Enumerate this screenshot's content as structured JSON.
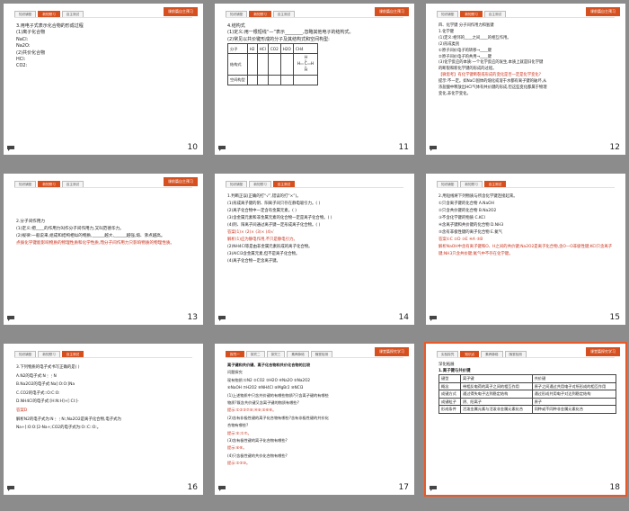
{
  "badge_text": "课前篇自主预习",
  "tabs_default": [
    "知识铺垫",
    "新知预习",
    "自主测试"
  ],
  "tabs_slide17": [
    "探究一",
    "探究二",
    "探究三",
    "素养脉络",
    "随堂检测"
  ],
  "tabs_slide18": [
    "实验探究",
    "知识点",
    "素养脉络",
    "随堂检测"
  ],
  "slides": [
    {
      "number": "10",
      "lines": [
        "3.用电子式表示化合物的形成过程",
        "(1)离子化合物",
        "NaCl:",
        "Na2O:",
        "(2)共价化合物",
        "HCl:",
        "CO2:"
      ]
    },
    {
      "number": "11",
      "lines": [
        "4.结构式",
        "(1)定义:用一根短线“—”表示________,忽略其他电子的结构式。",
        "(2)常见以共价键形成的分子及其结构式和空间构型:"
      ],
      "table": {
        "header": [
          "分子",
          "H2",
          "HCl",
          "CO2",
          "H2O",
          "CH4"
        ],
        "rows": [
          "结构式",
          "空间构型"
        ]
      }
    },
    {
      "number": "12",
      "lines": [
        "四、化学键 分子间作用力和氢键",
        "1.化学键",
        "(1)定义:相邻的____之间____的相互作用。",
        "(2)形成类别",
        "①原子间价电子的转移→____键",
        "②原子间价电子的共用→____键",
        "(3)化学反应的本质:一个化学反应的发生,本质上就是旧化学键",
        "的断裂和新化学键的形成的过程。",
        "【微思考】有化学键断裂或形成的变化是否一定是化学变化?",
        "提示:不一定。如NaCl固体的熔化或溶于水都有离子键的破坏,从",
        "浓盐酸中释放出HCl气体有共价键的形成,但这些变化都属于物理",
        "变化,非化学变化。"
      ]
    },
    {
      "number": "13",
      "lines": [
        "2.分子间作用力",
        "(1)定义:把____的作用力叫作分子间作用力,又叫范德华力。",
        "(2)规律:一般说来,组成和结构相似的物质,______越大,______越强,熔、沸点越高。",
        "点拨化学键能影响物质的物理性质和化学性质,而分子间作用力只影响物质的物理性质。"
      ]
    },
    {
      "number": "14",
      "lines": [
        "1.判断正误(正确的打“√”,错误的打“×”)。",
        "(1)形成离子键的阴、阳离子间只存在静电吸引力。(   )",
        "(2)离子化合物中一定含有金属元素。(   )",
        "(3)含金属元素和非金属元素的化合物一定是离子化合物。(   )",
        "(4)阴、阳离子间通过离子键一定形成离子化合物。(   )",
        "答案(1)×  (2)×  (3)×  (4)√",
        "解析(1)应为静电作用,不只是静电引力。",
        "(2)NH4Cl等是由非金属元素形成的离子化合物。",
        "(3)AlCl3含金属元素,但不是离子化合物。",
        "(4)离子化合物一定含离子键。"
      ]
    },
    {
      "number": "15",
      "lines": [
        "2.用短线将下列物质与所含化学键连接起来。",
        "①只含离子键的化合物        A.NaOH",
        "②只含共价键的化合物        B.Na2O2",
        "③不含化学键的物质          C.KCl",
        "④含离子键和共价键的化合物  D.NH3",
        "⑤含有非极性键的离子化合物  E.氦气",
        "答案①C ②D ③E ④A ⑤B",
        "解析NaOH中含有离子键和O、H之间的共价键;Na2O2是离子化合物,含O—O非极性键;KCl只含离子键;NH3只含共价键;氦气中不存在化学键。"
      ]
    },
    {
      "number": "16",
      "lines": [
        "3.下列物质的电子式书写正确的是(   )",
        "A.N2的电子式:N⋮⋮N",
        "B.Na2O2的电子式:Na[:O:O:]Na",
        "C.CO2的电子式::O:C:O:",
        "D.NH4Cl的电子式:[H:N:H]+[:Cl:]-",
        "答案D",
        "解析N2的电子式为:N⋮⋮N:;Na2O2是离子化合物,电子式为",
        "Na+[:O:O:]2-Na+;CO2的电子式为:O::C::O:。"
      ]
    },
    {
      "number": "17",
      "lines": [
        "离子键和共价键、离子化合物和共价化合物的比较",
        "问题探究",
        "现有物质:①N2 ②CO2 ③H2O ④Na2O ⑤Na2O2",
        "⑥NaOH ⑦H2O2 ⑧NH4Cl ⑨MgBr2 ⑩NCl3",
        "(1)上述物质中只含共价键的有哪些物质?只含离子键的有哪些",
        "物质?既含共价键又含离子键的物质有哪些?",
        "提示:①②③⑦⑩;④⑨;⑤⑥⑧。",
        "(2)含有非极性键的离子化合物有哪些?含有非极性键的共价化",
        "合物有哪些?",
        "提示:⑤;①⑦。",
        "(3)含有极性键的离子化合物有哪些?",
        "提示:⑥⑧。",
        "(4)只含极性键的共价化合物有哪些?",
        "提示:②③⑩。"
      ]
    },
    {
      "number": "18",
      "lines": [
        "深化拓展",
        "1.离子键与共价键"
      ],
      "compare": {
        "header": [
          "键型",
          "离子键",
          "共价键"
        ],
        "rows": [
          [
            "概念",
            "带相反电荷的离子之间的相互作用",
            "原子之间通过共用电子对所形成的相互作用"
          ],
          [
            "成键方式",
            "通过得失电子达到稳定结构",
            "通过形成共用电子对达到稳定结构"
          ],
          [
            "成键粒子",
            "阴、阳离子",
            "原子"
          ],
          [
            "形成条件",
            "活泼金属元素与活泼非金属元素化合",
            "同种或不同种非金属元素化合"
          ]
        ]
      }
    }
  ]
}
